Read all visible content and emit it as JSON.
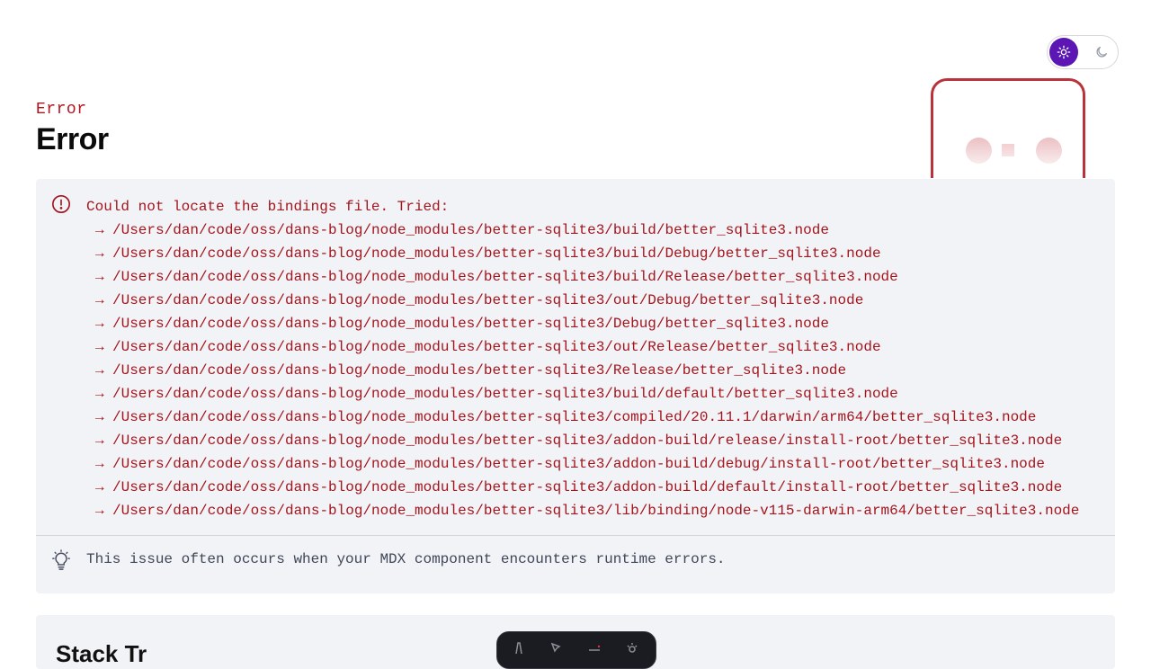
{
  "theme_toggle": {
    "options": [
      {
        "name": "light",
        "icon": "sun-icon",
        "active": true
      },
      {
        "name": "dark",
        "icon": "moon-icon",
        "active": false
      }
    ],
    "accent_color": "#5b16b3"
  },
  "error": {
    "code": "Error",
    "title": "Error",
    "message": "Could not locate the bindings file. Tried:",
    "arrow": "→",
    "paths": [
      "/Users/dan/code/oss/dans-blog/node_modules/better-sqlite3/build/better_sqlite3.node",
      "/Users/dan/code/oss/dans-blog/node_modules/better-sqlite3/build/Debug/better_sqlite3.node",
      "/Users/dan/code/oss/dans-blog/node_modules/better-sqlite3/build/Release/better_sqlite3.node",
      "/Users/dan/code/oss/dans-blog/node_modules/better-sqlite3/out/Debug/better_sqlite3.node",
      "/Users/dan/code/oss/dans-blog/node_modules/better-sqlite3/Debug/better_sqlite3.node",
      "/Users/dan/code/oss/dans-blog/node_modules/better-sqlite3/out/Release/better_sqlite3.node",
      "/Users/dan/code/oss/dans-blog/node_modules/better-sqlite3/Release/better_sqlite3.node",
      "/Users/dan/code/oss/dans-blog/node_modules/better-sqlite3/build/default/better_sqlite3.node",
      "/Users/dan/code/oss/dans-blog/node_modules/better-sqlite3/compiled/20.11.1/darwin/arm64/better_sqlite3.node",
      "/Users/dan/code/oss/dans-blog/node_modules/better-sqlite3/addon-build/release/install-root/better_sqlite3.node",
      "/Users/dan/code/oss/dans-blog/node_modules/better-sqlite3/addon-build/debug/install-root/better_sqlite3.node",
      "/Users/dan/code/oss/dans-blog/node_modules/better-sqlite3/addon-build/default/install-root/better_sqlite3.node",
      "/Users/dan/code/oss/dans-blog/node_modules/better-sqlite3/lib/binding/node-v115-darwin-arm64/better_sqlite3.node"
    ],
    "hint": "This issue often occurs when your MDX component encounters runtime errors.",
    "error_color": "#a3151d"
  },
  "stack": {
    "title": "Stack Tr"
  },
  "dev_toolbar": {
    "icons": [
      "astro-icon",
      "inspect-icon",
      "audit-icon",
      "settings-icon"
    ]
  }
}
